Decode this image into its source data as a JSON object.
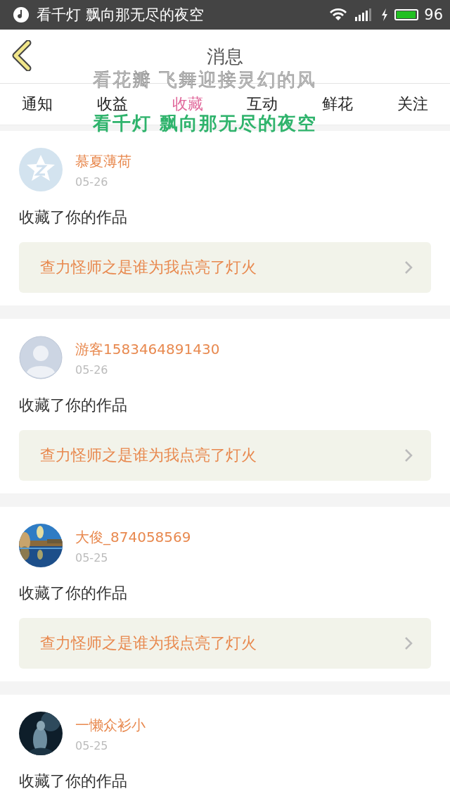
{
  "status_bar": {
    "notification": "看千灯 飘向那无尽的夜空",
    "battery": "96"
  },
  "header": {
    "title": "消息"
  },
  "tabs": [
    {
      "label": "通知",
      "selected": false
    },
    {
      "label": "收益",
      "selected": false
    },
    {
      "label": "收藏",
      "selected": true
    },
    {
      "label": "互动",
      "selected": false
    },
    {
      "label": "鲜花",
      "selected": false
    },
    {
      "label": "关注",
      "selected": false
    }
  ],
  "lyrics_overlay": {
    "line_1": "看花瓣 飞舞迎接灵幻的风",
    "line_2": "看千灯 飘向那无尽的夜空"
  },
  "messages": [
    {
      "kind": "default_star",
      "user": "慕夏薄荷",
      "date": "05-26",
      "text": "收藏了你的作品",
      "work": "查力怪师之是谁为我点亮了灯火"
    },
    {
      "kind": "default_person",
      "user": "游客1583464891430",
      "date": "05-26",
      "text": "收藏了你的作品",
      "work": "查力怪师之是谁为我点亮了灯火"
    },
    {
      "kind": "photo_lake",
      "user": "大俊_874058569",
      "date": "05-25",
      "text": "收藏了你的作品",
      "work": "查力怪师之是谁为我点亮了灯火"
    },
    {
      "kind": "photo_dark",
      "user": "一懒众衫小",
      "date": "05-25",
      "text": "收藏了你的作品"
    }
  ]
}
